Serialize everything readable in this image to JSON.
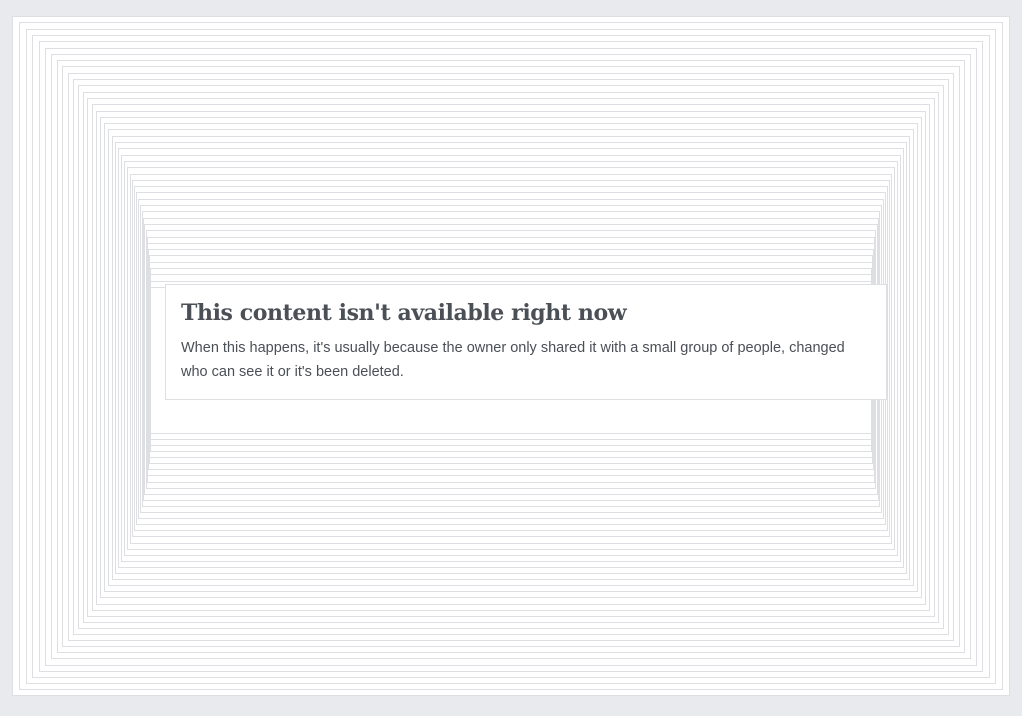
{
  "notice": {
    "title": "This content isn't available right now",
    "body": "When this happens, it's usually because the owner only shared it with a small group of people, changed who can see it or it's been deleted."
  },
  "colors": {
    "background": "#e9eaee",
    "card": "#ffffff",
    "text": "#4b4f56",
    "border": "#dddfe2"
  }
}
